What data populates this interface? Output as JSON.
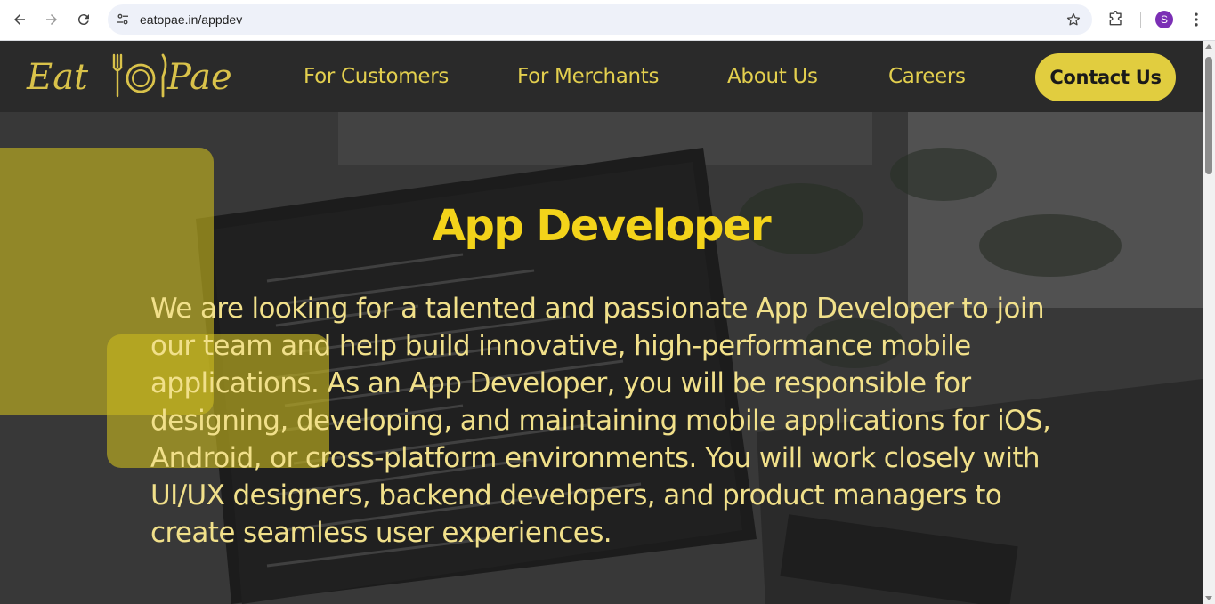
{
  "browser": {
    "url": "eatopae.in/appdev",
    "profile_initial": "S",
    "icons": {
      "back": "back-arrow-icon",
      "forward": "forward-arrow-icon",
      "reload": "reload-icon",
      "site_info": "tune-icon",
      "bookmark": "star-icon",
      "extensions": "puzzle-icon",
      "menu": "kebab-menu-icon"
    }
  },
  "header": {
    "logo_text": "Eat Pae",
    "nav": [
      {
        "label": "For Customers"
      },
      {
        "label": "For Merchants"
      },
      {
        "label": "About Us"
      },
      {
        "label": "Careers"
      }
    ],
    "contact_label": "Contact Us"
  },
  "hero": {
    "title": "App Developer",
    "description": "We are looking for a talented and passionate App Developer to join our team and help build innovative, high-performance mobile applications. As an App Developer, you will be responsible for designing, developing, and maintaining mobile applications for iOS, Android, or cross-platform environments. You will work closely with UI/UX designers, backend developers, and product managers to create seamless user experiences."
  },
  "colors": {
    "header_bg": "#2a2a2a",
    "accent_yellow": "#e1cd3f",
    "title_yellow": "#f3d31a",
    "text_yellow": "#f1e08a"
  }
}
